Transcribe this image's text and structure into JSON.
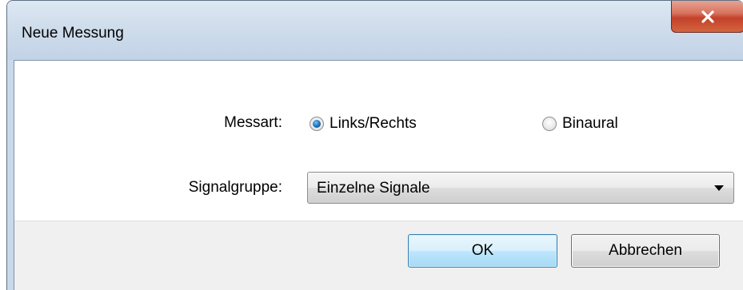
{
  "window": {
    "title": "Neue Messung"
  },
  "icons": {
    "close": "close-icon",
    "dropdown": "chevron-down-icon"
  },
  "colors": {
    "close_button": "#c4412a",
    "title_bar": "#cfdceb",
    "ok_button": "#bee6fd",
    "radio_selected": "#1c6cb9"
  },
  "form": {
    "measurement_type": {
      "label": "Messart:",
      "options": [
        {
          "label": "Links/Rechts",
          "selected": true
        },
        {
          "label": "Binaural",
          "selected": false
        }
      ]
    },
    "signal_group": {
      "label": "Signalgruppe:",
      "value": "Einzelne Signale"
    }
  },
  "buttons": {
    "ok": "OK",
    "cancel": "Abbrechen"
  }
}
